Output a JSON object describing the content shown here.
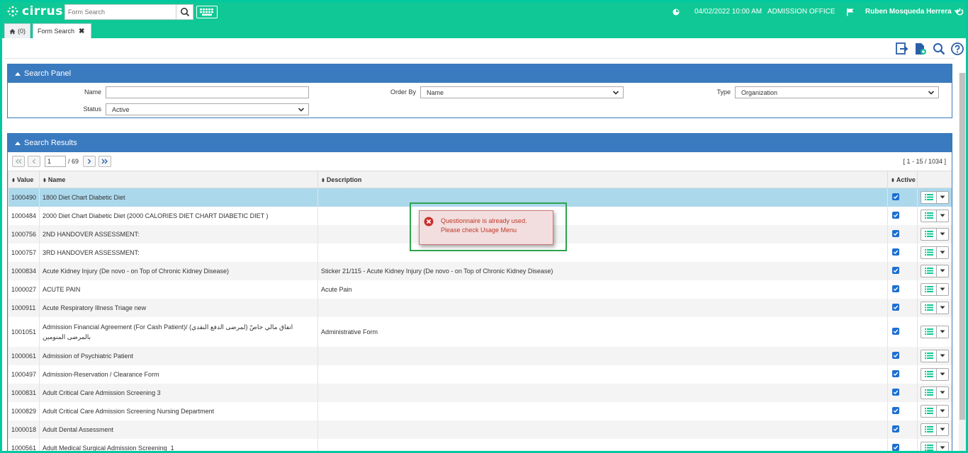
{
  "app": {
    "logo_text": "cirrus"
  },
  "header": {
    "search_placeholder": "Form Search",
    "datetime": "04/02/2022 10:00 AM",
    "location": "ADMISSION OFFICE",
    "user": "Ruben Mosqueda Herrera"
  },
  "tabs": [
    {
      "label": "(0)"
    },
    {
      "label": "Form Search"
    }
  ],
  "search_panel": {
    "title": "Search Panel",
    "name_label": "Name",
    "name_value": "",
    "order_by_label": "Order By",
    "order_by_value": "Name",
    "type_label": "Type",
    "type_value": "Organization",
    "status_label": "Status",
    "status_value": "Active"
  },
  "results": {
    "title": "Search Results",
    "page": "1",
    "total_pages": "/ 69",
    "range": "[ 1 - 15 / 1034 ]",
    "columns": {
      "value": "Value",
      "name": "Name",
      "description": "Description",
      "active": "Active"
    },
    "rows": [
      {
        "value": "1000490",
        "name": "1800 Diet Chart Diabetic Diet",
        "description": ""
      },
      {
        "value": "1000484",
        "name": "2000 Diet Chart Diabetic Diet (2000 CALORIES DIET CHART DIABETIC DIET )",
        "description": ""
      },
      {
        "value": "1000756",
        "name": "2ND HANDOVER ASSESSMENT:",
        "description": ""
      },
      {
        "value": "1000757",
        "name": "3RD HANDOVER ASSESSMENT:",
        "description": ""
      },
      {
        "value": "1000834",
        "name": "Acute Kidney Injury (De novo - on Top of Chronic Kidney Disease)",
        "description": "Sticker 21/115 - Acute Kidney Injury (De novo - on Top of Chronic Kidney Disease)"
      },
      {
        "value": "1000027",
        "name": "ACUTE PAIN",
        "description": "Acute Pain"
      },
      {
        "value": "1000911",
        "name": "Acute Respiratory Illness Triage new",
        "description": ""
      },
      {
        "value": "1001051",
        "name": "Admission Financial Agreement (For Cash Patient)/ (لمرضى الدفع النقدي) اتفاق مالي خاصّ بالمرضى المنومين",
        "description": "Administrative Form"
      },
      {
        "value": "1000061",
        "name": "Admission of Psychiatric Patient",
        "description": ""
      },
      {
        "value": "1000497",
        "name": "Admission-Reservation / Clearance Form",
        "description": ""
      },
      {
        "value": "1000831",
        "name": "Adult Critical Care Admission Screening 3",
        "description": ""
      },
      {
        "value": "1000829",
        "name": "Adult Critical Care Admission Screening Nursing Department",
        "description": ""
      },
      {
        "value": "1000018",
        "name": "Adult Dental Assessment",
        "description": ""
      },
      {
        "value": "1000561",
        "name": "Adult Medical Surgical Admission Screening_1",
        "description": ""
      }
    ]
  },
  "error_toast": {
    "line1": "Questionnaire is already used.",
    "line2": "Please check Usage Menu"
  }
}
